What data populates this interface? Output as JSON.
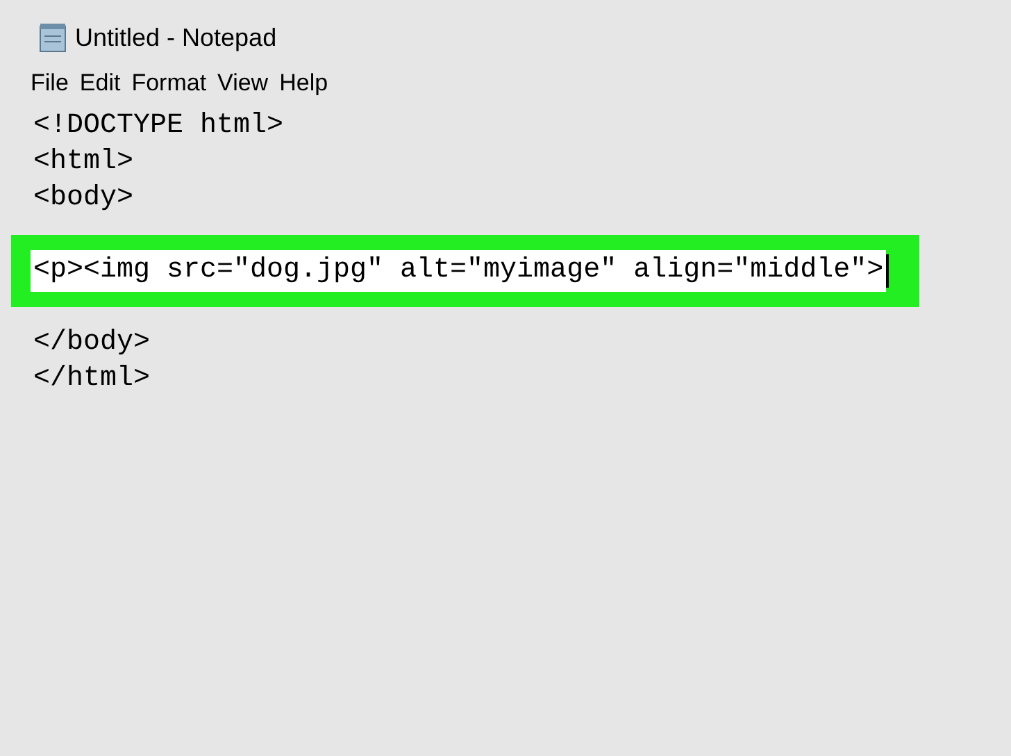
{
  "window": {
    "title": "Untitled - Notepad"
  },
  "menu": [
    "File",
    "Edit",
    "Format",
    "View",
    "Help"
  ],
  "editor": {
    "lines": [
      {
        "kind": "text",
        "text": "<!DOCTYPE html>",
        "highlighted": false,
        "cursor": false
      },
      {
        "kind": "text",
        "text": "<html>",
        "highlighted": false,
        "cursor": false
      },
      {
        "kind": "text",
        "text": "<body>",
        "highlighted": false,
        "cursor": false
      },
      {
        "kind": "blank"
      },
      {
        "kind": "text",
        "text": "<p><img src=\"dog.jpg\" alt=\"myimage\" align=\"middle\">",
        "highlighted": true,
        "cursor": true
      },
      {
        "kind": "blank"
      },
      {
        "kind": "text",
        "text": "</body>",
        "highlighted": false,
        "cursor": false
      },
      {
        "kind": "text",
        "text": "</html>",
        "highlighted": false,
        "cursor": false
      }
    ]
  }
}
